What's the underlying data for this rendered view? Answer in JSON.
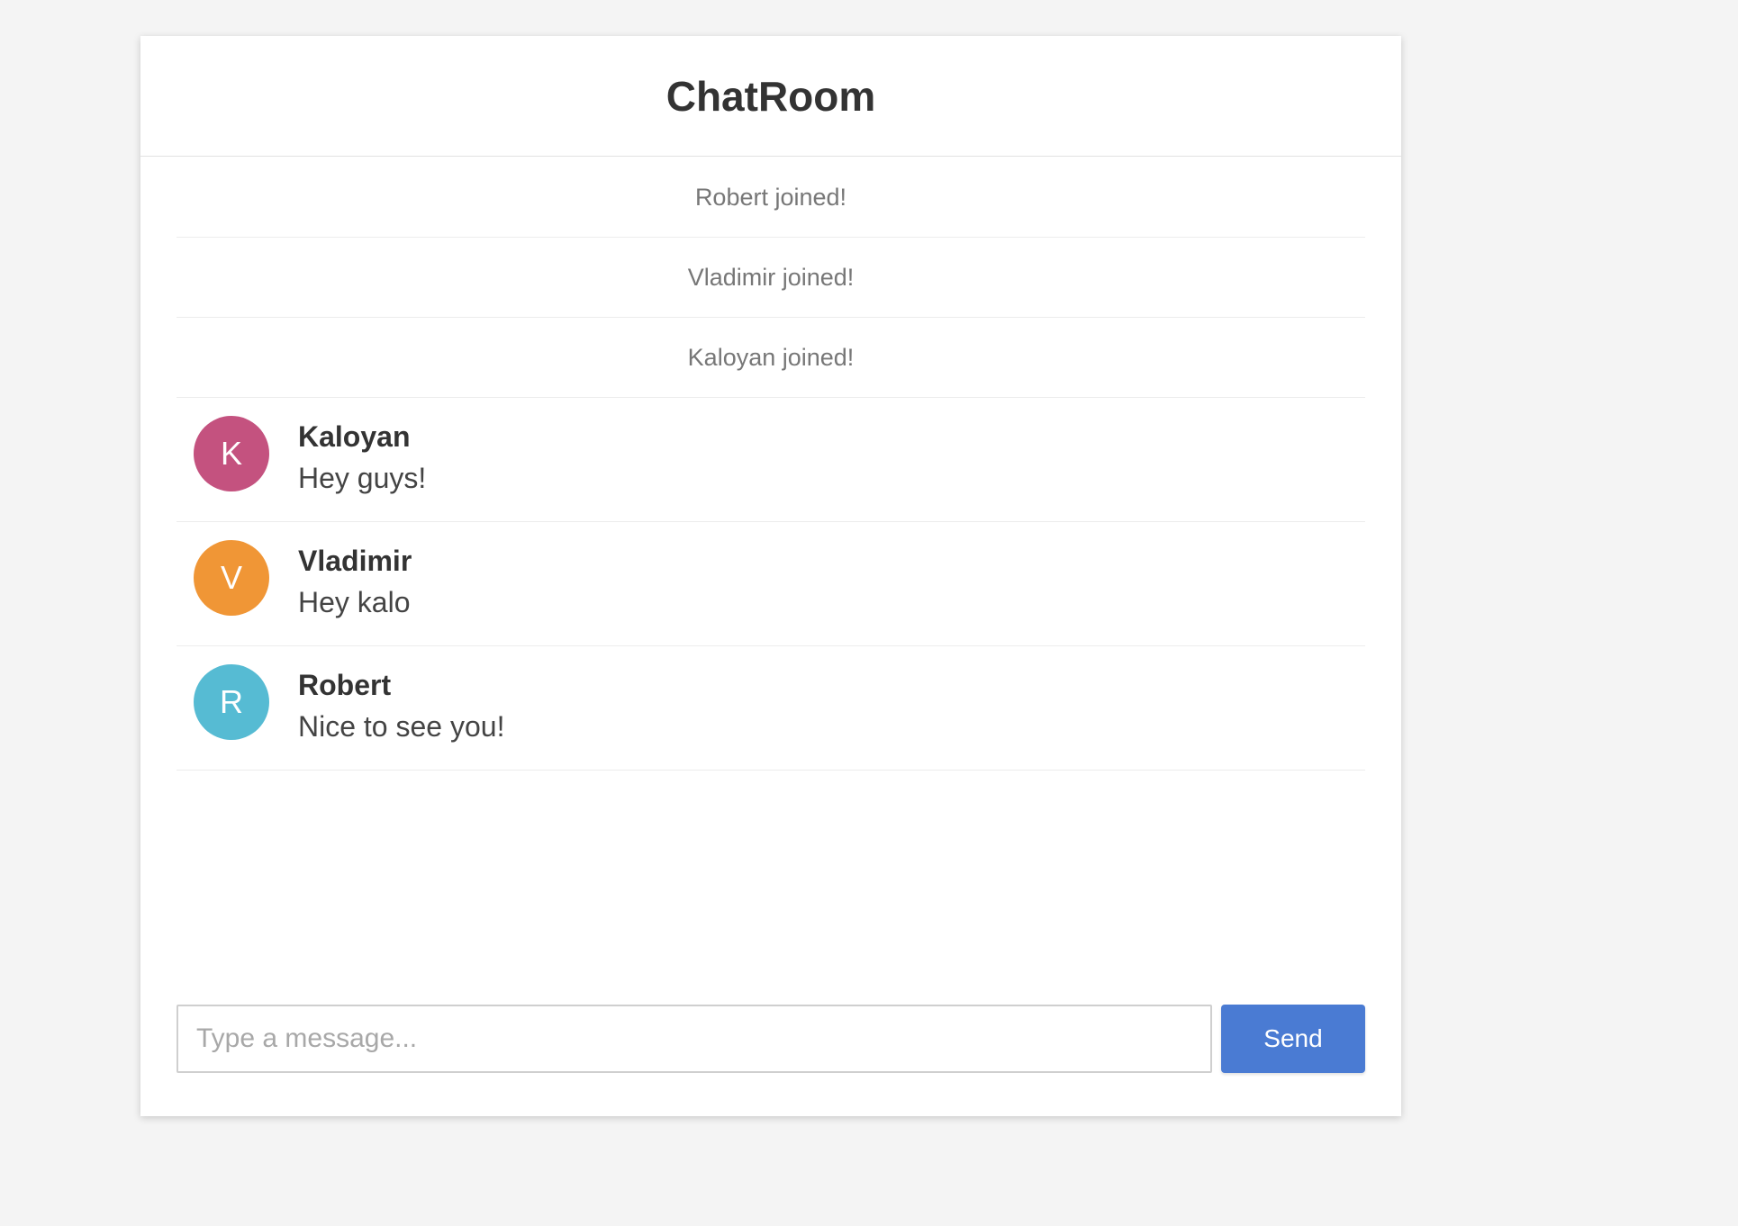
{
  "header": {
    "title": "ChatRoom"
  },
  "events": [
    {
      "text": "Robert joined!"
    },
    {
      "text": "Vladimir joined!"
    },
    {
      "text": "Kaloyan joined!"
    }
  ],
  "messages": [
    {
      "initial": "K",
      "sender": "Kaloyan",
      "text": "Hey guys!",
      "avatar_color": "#c4527f"
    },
    {
      "initial": "V",
      "sender": "Vladimir",
      "text": "Hey kalo",
      "avatar_color": "#f09636"
    },
    {
      "initial": "R",
      "sender": "Robert",
      "text": "Nice to see you!",
      "avatar_color": "#56bbd3"
    }
  ],
  "composer": {
    "placeholder": "Type a message...",
    "value": "",
    "send_label": "Send"
  },
  "colors": {
    "accent": "#4a7bd3",
    "background": "#f4f4f4"
  }
}
